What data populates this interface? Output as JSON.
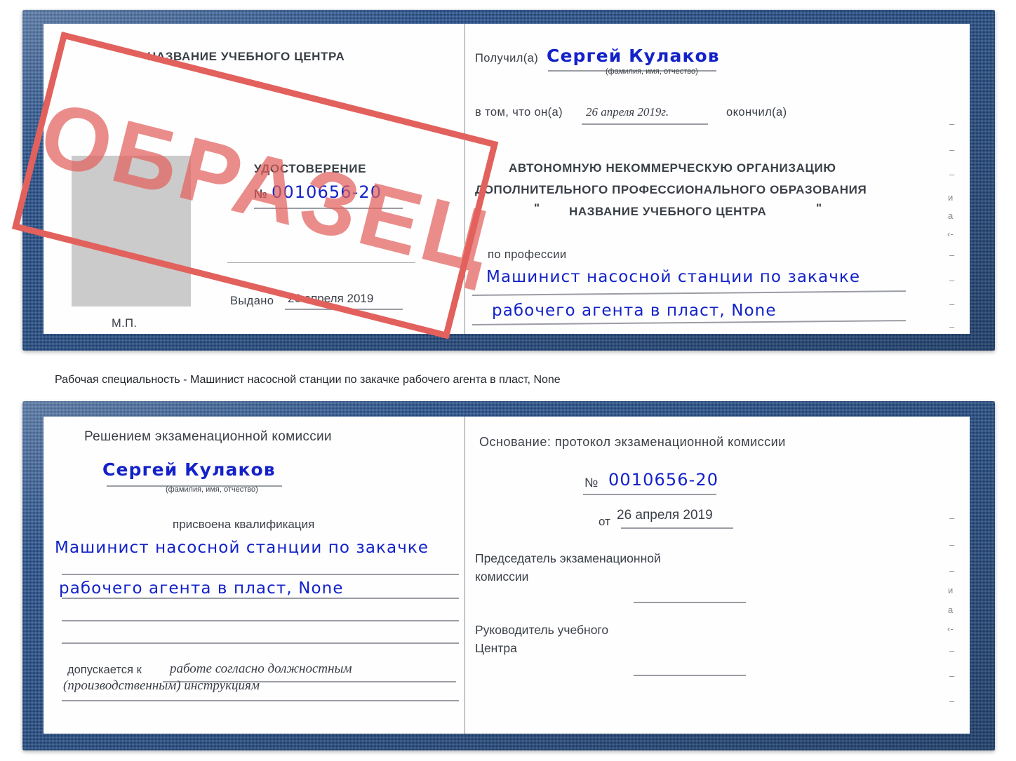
{
  "document": {
    "type": "certificate-scan",
    "colors": {
      "cover_blue": "#24508e",
      "watermark_red": "#e2615d",
      "handwriting_blue": "#1322c8",
      "paper_white": "#fefefe",
      "photo_placeholder_gray": "#cbcbcb"
    }
  },
  "watermark": {
    "text": "ОБРАЗЕЦ"
  },
  "certificate_top": {
    "left_page": {
      "center_title": "НАЗВАНИЕ УЧЕБНОГО ЦЕНТРА",
      "doc_kind": "УДОСТОВЕРЕНИЕ",
      "number_label": "№",
      "number_value": "0010656-20",
      "issued_label": "Выдано",
      "issued_value": "26 апреля 2019",
      "stamp_label": "М.П."
    },
    "right_page": {
      "received_label": "Получил(а)",
      "received_value": "Сергей Кулаков",
      "name_hint": "(фамилия, имя, отчество)",
      "in_that_label": "в том, что он(а)",
      "completion_date": "26 апреля 2019г.",
      "finished_label": "окончил(а)",
      "org_line1": "АВТОНОМНУЮ НЕКОММЕРЧЕСКУЮ ОРГАНИЗАЦИЮ",
      "org_line2": "ДОПОЛНИТЕЛЬНОГО ПРОФЕССИОНАЛЬНОГО ОБРАЗОВАНИЯ",
      "org_quote_open": "\"",
      "org_line3": "НАЗВАНИЕ УЧЕБНОГО ЦЕНТРА",
      "org_quote_close": "\"",
      "profession_label": "по профессии",
      "profession_line1": "Машинист насосной станции по закачке",
      "profession_line2": "рабочего агента в пласт, None"
    }
  },
  "caption": {
    "text": "Рабочая специальность - Машинист насосной станции по закачке рабочего агента в пласт, None"
  },
  "certificate_bottom": {
    "left_page": {
      "heading": "Решением экзаменационной комиссии",
      "name_value": "Сергей Кулаков",
      "name_hint": "(фамилия, имя, отчество)",
      "qualification_label": "присвоена квалификация",
      "qualification_line1": "Машинист насосной станции по закачке",
      "qualification_line2": "рабочего агента в пласт, None",
      "admitted_label": "допускается к",
      "admitted_line1": "работе согласно должностным",
      "admitted_line2": "(производственным) инструкциям"
    },
    "right_page": {
      "basis_label": "Основание: протокол экзаменационной комиссии",
      "number_label": "№",
      "number_value": "0010656-20",
      "date_label": "от",
      "date_value": "26 апреля 2019",
      "chairman_line1": "Председатель экзаменационной",
      "chairman_line2": "комиссии",
      "head_line1": "Руководитель учебного",
      "head_line2": "Центра"
    }
  },
  "scan_artifacts": {
    "top_right_marks": [
      "–",
      "–",
      "–",
      "и",
      "а",
      "‹-",
      "–",
      "–",
      "–",
      "–"
    ],
    "bottom_right_marks": [
      "–",
      "–",
      "–",
      "и",
      "а",
      "‹-",
      "–",
      "–",
      "–"
    ]
  }
}
